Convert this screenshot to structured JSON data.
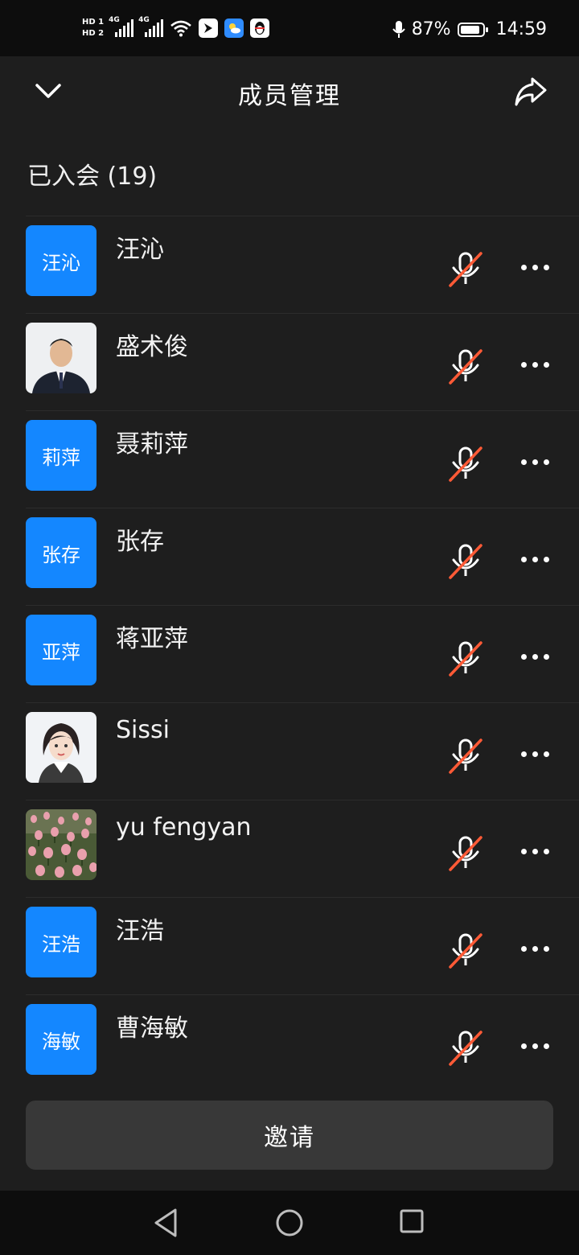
{
  "status_bar": {
    "hd1": "HD 1",
    "hd2": "HD 2",
    "net1": "4G",
    "net2": "4G",
    "battery": "87%",
    "battery_level": 0.87,
    "time": "14:59"
  },
  "header": {
    "title": "成员管理",
    "back_icon": "chevron-down-icon",
    "share_icon": "share-icon"
  },
  "section": {
    "title": "已入会 (19)"
  },
  "members": [
    {
      "name": "汪沁",
      "avatar_text": "汪沁",
      "avatar_type": "text",
      "muted": true
    },
    {
      "name": "盛术俊",
      "avatar_text": "",
      "avatar_type": "photo-man",
      "muted": true
    },
    {
      "name": "聂莉萍",
      "avatar_text": "莉萍",
      "avatar_type": "text",
      "muted": true
    },
    {
      "name": "张存",
      "avatar_text": "张存",
      "avatar_type": "text",
      "muted": true
    },
    {
      "name": "蒋亚萍",
      "avatar_text": "亚萍",
      "avatar_type": "text",
      "muted": true
    },
    {
      "name": "Sissi",
      "avatar_text": "",
      "avatar_type": "cartoon-girl",
      "muted": true
    },
    {
      "name": "yu fengyan",
      "avatar_text": "",
      "avatar_type": "photo-tulips",
      "muted": true
    },
    {
      "name": "汪浩",
      "avatar_text": "汪浩",
      "avatar_type": "text",
      "muted": true
    },
    {
      "name": "曹海敏",
      "avatar_text": "海敏",
      "avatar_type": "text",
      "muted": true
    }
  ],
  "invite_label": "邀请",
  "colors": {
    "accent_blue": "#1487ff",
    "mute_slash": "#ff5a36",
    "panel_bg": "#1e1e1e",
    "button_bg": "#383838"
  }
}
